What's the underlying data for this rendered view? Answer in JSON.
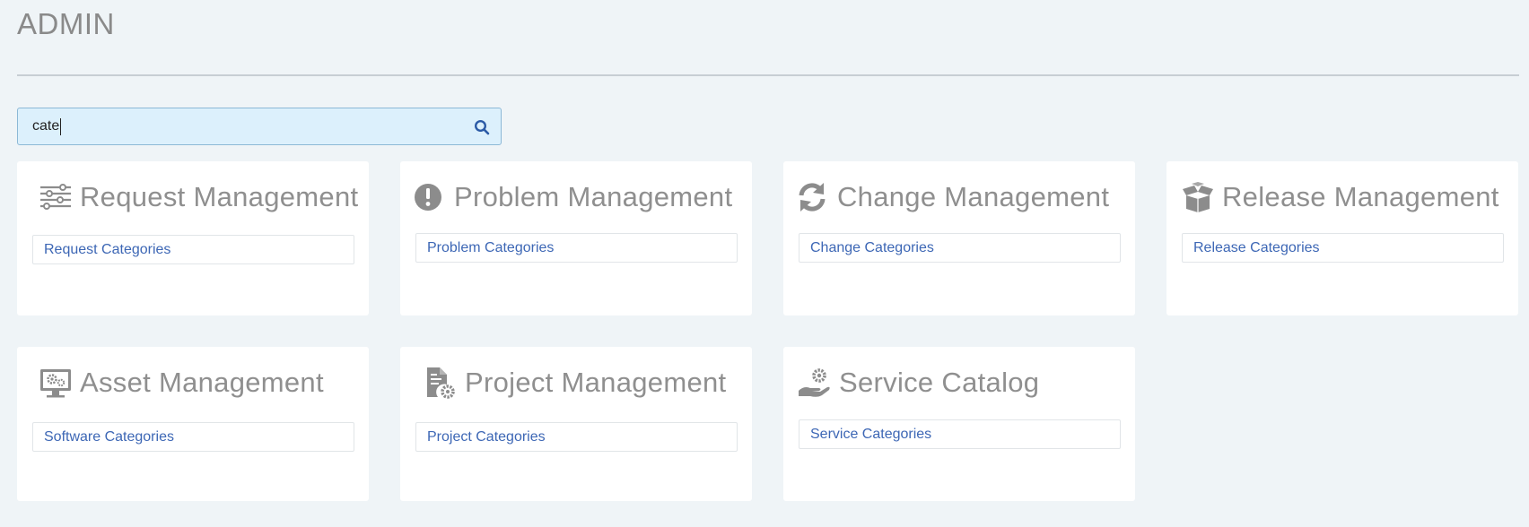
{
  "page": {
    "title": "ADMIN"
  },
  "search": {
    "value": "cate"
  },
  "cards": [
    {
      "title": "Request Management",
      "icon": "sliders-icon",
      "link": "Request Categories"
    },
    {
      "title": "Problem Management",
      "icon": "exclamation-circle-icon",
      "link": "Problem Categories"
    },
    {
      "title": "Change Management",
      "icon": "refresh-icon",
      "link": "Change Categories"
    },
    {
      "title": "Release Management",
      "icon": "open-box-icon",
      "link": "Release Categories"
    },
    {
      "title": "Asset Management",
      "icon": "monitor-gears-icon",
      "link": "Software Categories"
    },
    {
      "title": "Project Management",
      "icon": "document-gear-icon",
      "link": "Project Categories"
    },
    {
      "title": "Service Catalog",
      "icon": "hand-gear-icon",
      "link": "Service Categories"
    }
  ],
  "colors": {
    "background": "#eff4f7",
    "title": "#8a8a8a",
    "link": "#3d67b5",
    "search_bg": "#dcf0fc",
    "search_border": "#8cb8d6",
    "icon": "#8c8c8c"
  }
}
